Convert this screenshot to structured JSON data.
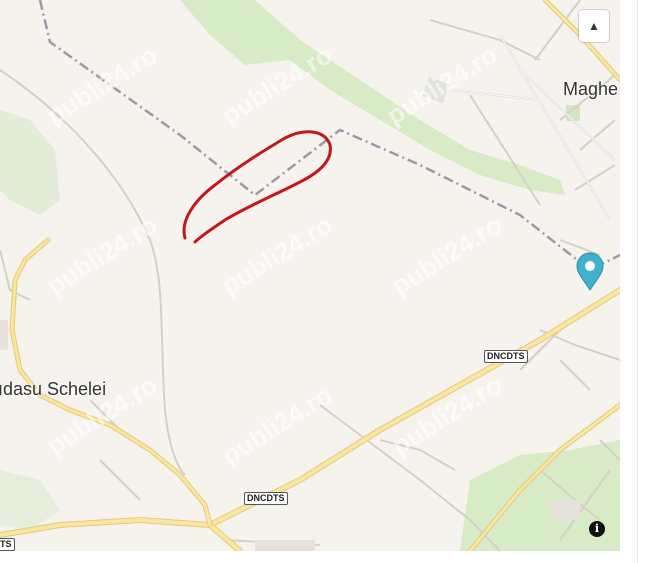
{
  "map": {
    "places": [
      {
        "id": "maghera",
        "label": "Maghe"
      },
      {
        "id": "sudasu",
        "label": "ıdasu Schelei"
      }
    ],
    "road_shields": [
      {
        "id": "dncdts-1",
        "label": "DNCDTS"
      },
      {
        "id": "dncdts-2",
        "label": "DNCDTS"
      },
      {
        "id": "dncdts-3",
        "label": "TS"
      }
    ],
    "watermark": "publi24.ro",
    "controls": {
      "compass_glyph": "▲",
      "info_glyph": "i"
    },
    "colors": {
      "land": "#f6f3ee",
      "forest": "#d7ebc6",
      "road_major": "#f7e7a3",
      "road_major_outline": "#e8c877",
      "road_minor": "#ffffff",
      "road_minor_outline": "#d4d0c9",
      "boundary": "#9a9aa8",
      "annotation": "#c4161c",
      "marker": "#3fb1ce"
    },
    "icons": [
      "compass-icon",
      "info-icon",
      "location-pin-icon"
    ]
  }
}
